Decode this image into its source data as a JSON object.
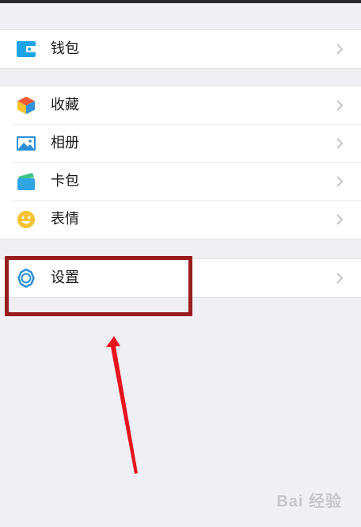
{
  "menu": {
    "wallet": {
      "label": "钱包",
      "icon": "wallet-icon"
    },
    "favorites": {
      "label": "收藏",
      "icon": "cube-icon"
    },
    "album": {
      "label": "相册",
      "icon": "picture-icon"
    },
    "card_pack": {
      "label": "卡包",
      "icon": "card-icon"
    },
    "stickers": {
      "label": "表情",
      "icon": "smiley-icon"
    },
    "settings": {
      "label": "设置",
      "icon": "gear-icon"
    }
  },
  "watermark": {
    "text": "Bai 经验"
  },
  "colors": {
    "background": "#efeff4",
    "annotation_box": "#9b1c1c",
    "annotation_arrow": "#e8121d",
    "wallet_icon": "#1aa3e8",
    "settings_icon": "#2b8fd6",
    "smiley_icon": "#f7c231"
  }
}
